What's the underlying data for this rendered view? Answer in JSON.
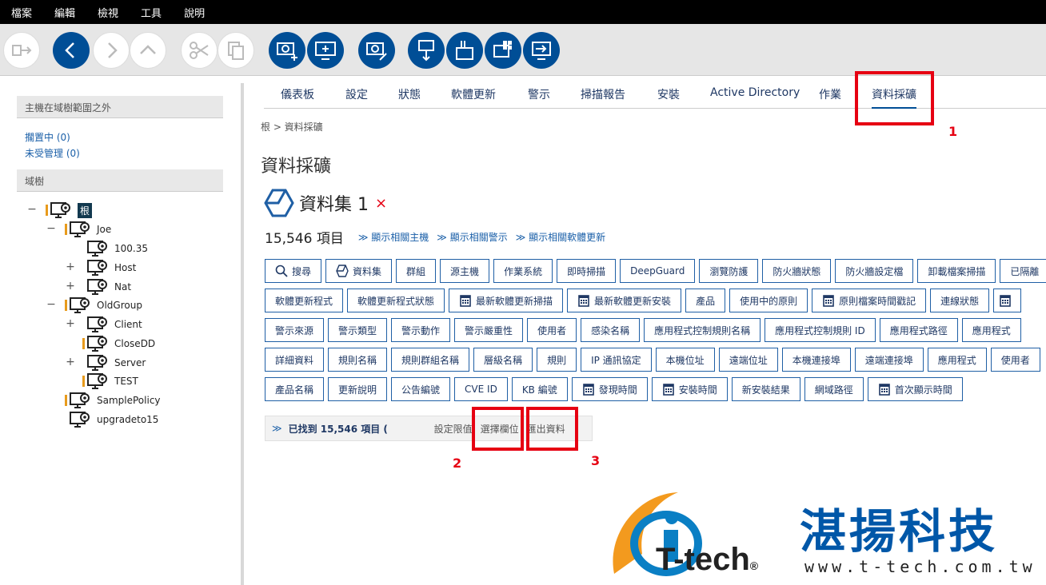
{
  "menu": [
    "檔案",
    "編輯",
    "檢視",
    "工具",
    "說明"
  ],
  "toolbar_icons": [
    "connect-icon",
    "back-icon",
    "forward-icon",
    "up-icon",
    "cut-icon",
    "copy-icon",
    "add-host-gear-icon",
    "add-host-icon",
    "edit-gear-icon",
    "download-host-icon",
    "transfer-icon",
    "windows-host-icon",
    "export-host-icon"
  ],
  "left": {
    "outside_header": "主機在域樹範圍之外",
    "pending": "擱置中 (0)",
    "unmanaged": "未受管理 (0)",
    "tree_header": "域樹",
    "tree": [
      {
        "label": "根",
        "sign": "−"
      },
      {
        "label": "Joe",
        "sign": "−"
      },
      {
        "label": "100.35",
        "sign": ""
      },
      {
        "label": "Host",
        "sign": "+"
      },
      {
        "label": "Nat",
        "sign": "+"
      },
      {
        "label": "OldGroup",
        "sign": "−"
      },
      {
        "label": "Client",
        "sign": "+"
      },
      {
        "label": "CloseDD",
        "sign": ""
      },
      {
        "label": "Server",
        "sign": "+"
      },
      {
        "label": "TEST",
        "sign": ""
      },
      {
        "label": "SamplePolicy",
        "sign": ""
      },
      {
        "label": "upgradeto15",
        "sign": ""
      }
    ]
  },
  "tabs": [
    "儀表板",
    "設定",
    "狀態",
    "軟體更新",
    "警示",
    "掃描報告",
    "安裝",
    "Active Directory",
    "作業",
    "資料採礦"
  ],
  "breadcrumb": "根 > 資料採礦",
  "page_title": "資料採礦",
  "dataset": {
    "name": "資料集 1",
    "close": "×"
  },
  "count": "15,546 項目",
  "show_links": [
    "顯示相關主機",
    "顯示相關警示",
    "顯示相關軟體更新"
  ],
  "chips": [
    [
      "搜尋",
      "資料集",
      "群組",
      "源主機",
      "作業系統",
      "即時掃描",
      "DeepGuard",
      "瀏覽防護",
      "防火牆狀態",
      "防火牆設定檔",
      "卸載檔案掃描",
      "已隔離"
    ],
    [
      "軟體更新程式",
      "軟體更新程式狀態",
      "最新軟體更新掃描",
      "最新軟體更新安裝",
      "產品",
      "使用中的原則",
      "原則檔案時間戳記",
      "連線狀態",
      ""
    ],
    [
      "警示來源",
      "警示類型",
      "警示動作",
      "警示嚴重性",
      "使用者",
      "感染名稱",
      "應用程式控制規則名稱",
      "應用程式控制規則 ID",
      "應用程式路徑",
      "應用程式"
    ],
    [
      "詳細資料",
      "規則名稱",
      "規則群組名稱",
      "層級名稱",
      "規則",
      "IP 通訊協定",
      "本機位址",
      "遠端位址",
      "本機連接埠",
      "遠端連接埠",
      "應用程式",
      "使用者"
    ],
    [
      "產品名稱",
      "更新說明",
      "公告編號",
      "CVE ID",
      "KB 編號",
      "發現時間",
      "安裝時間",
      "新安裝結果",
      "網域路徑",
      "首次顯示時間"
    ]
  ],
  "found": "已找到 15,546 項目 (",
  "found_links": [
    "設定限值",
    "選擇欄位",
    "匯出資料"
  ],
  "annotations": [
    "1",
    "2",
    "3"
  ],
  "logo": {
    "cn": "湛揚科技",
    "tech": "T-tech",
    "reg": "®",
    "url": "www.t-tech.com.tw"
  },
  "colors": {
    "accent": "#004e96",
    "highlight": "#e60012",
    "tree_mark": "#e89b1c"
  }
}
